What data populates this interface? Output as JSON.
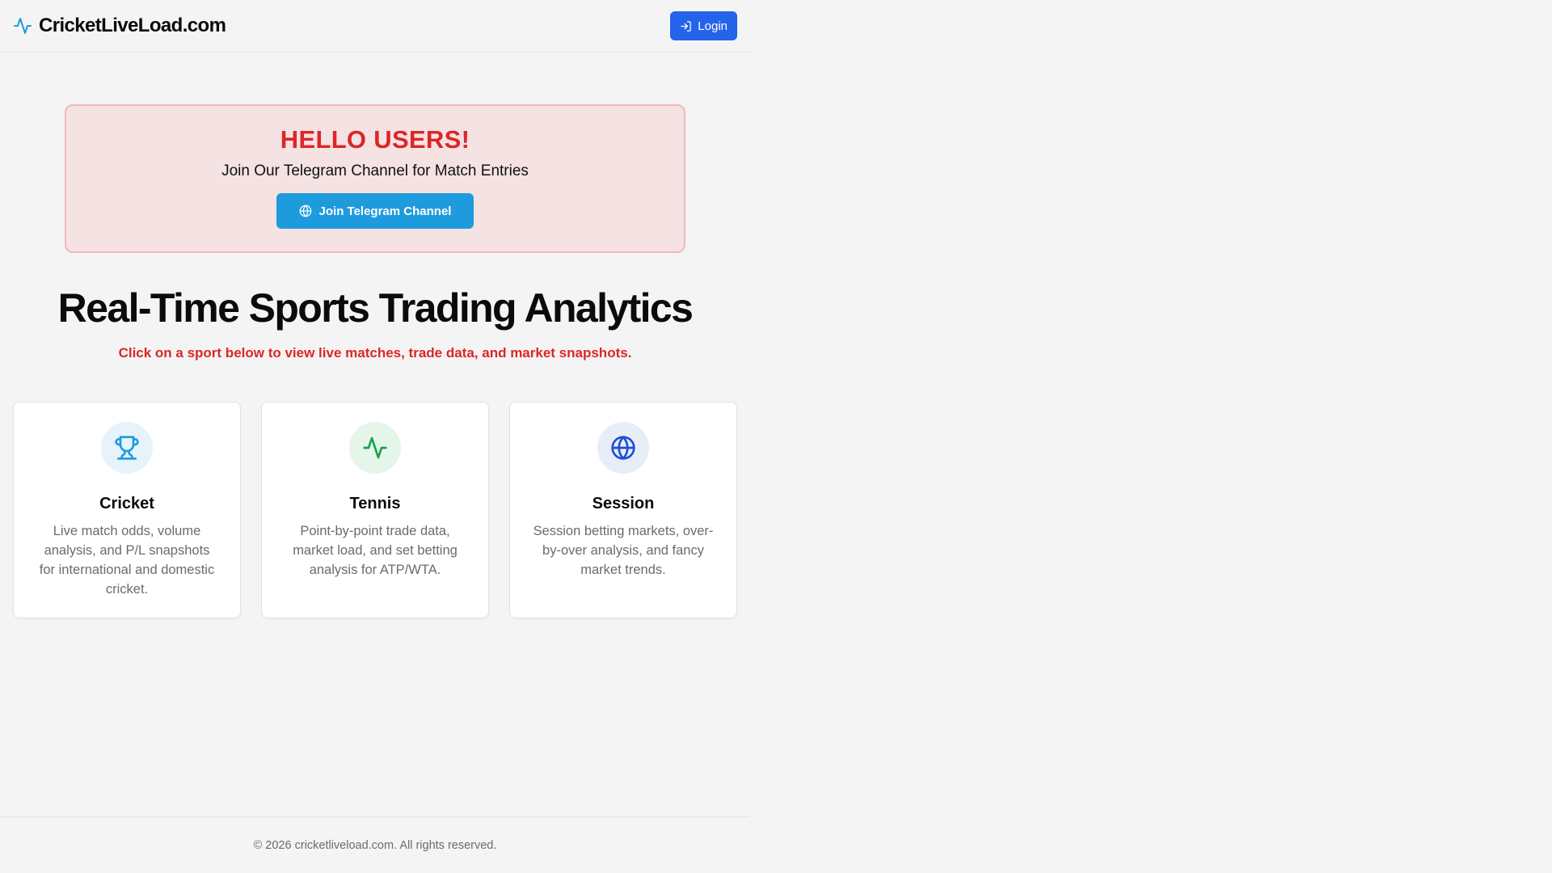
{
  "header": {
    "brand": "CricketLiveLoad.com",
    "brand_icon": "activity-pulse-icon",
    "login_label": "Login",
    "login_icon": "log-in-icon"
  },
  "banner": {
    "title": "HELLO USERS!",
    "subtitle": "Join Our Telegram Channel for Match Entries",
    "button_label": "Join Telegram Channel",
    "button_icon": "globe-icon"
  },
  "hero": {
    "title": "Real-Time Sports Trading Analytics",
    "subtitle": "Click on a sport below to view live matches, trade data, and market snapshots."
  },
  "sports": [
    {
      "title": "Cricket",
      "description": "Live match odds, volume analysis, and P/L snapshots for international and domestic cricket.",
      "icon": "trophy-icon",
      "icon_color": "#1e9bdc",
      "icon_bg": "#e6f3fa"
    },
    {
      "title": "Tennis",
      "description": "Point-by-point trade data, market load, and set betting analysis for ATP/WTA.",
      "icon": "activity-pulse-icon",
      "icon_color": "#16a34a",
      "icon_bg": "#e6f5ea"
    },
    {
      "title": "Session",
      "description": "Session betting markets, over-by-over analysis, and fancy market trends.",
      "icon": "globe-icon",
      "icon_color": "#1d4ed8",
      "icon_bg": "#e8eef8"
    }
  ],
  "footer": {
    "text": "© 2026 cricketliveload.com. All rights reserved."
  },
  "colors": {
    "accent_blue": "#2563eb",
    "telegram_blue": "#1e9bdc",
    "alert_red": "#dc2626",
    "banner_bg": "#f5e2e3",
    "banner_border": "#f1b8bd"
  }
}
